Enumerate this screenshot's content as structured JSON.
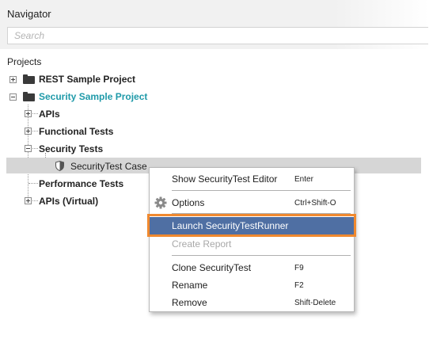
{
  "header": {
    "title": "Navigator"
  },
  "search": {
    "placeholder": "Search",
    "value": ""
  },
  "section": {
    "label": "Projects"
  },
  "tree": {
    "projects": [
      {
        "label": "REST Sample Project",
        "expanded": false
      },
      {
        "label": "Security Sample Project",
        "expanded": true
      }
    ],
    "children": [
      {
        "label": "APIs"
      },
      {
        "label": "Functional Tests"
      },
      {
        "label": "Security Tests"
      },
      {
        "label": "SecurityTest Case"
      },
      {
        "label": "Performance Tests"
      },
      {
        "label": "APIs (Virtual)"
      }
    ]
  },
  "context_menu": {
    "items": [
      {
        "label": "Show SecurityTest Editor",
        "shortcut": "Enter"
      },
      {
        "label": "Options",
        "shortcut": "Ctrl+Shift-O",
        "icon": "gear-icon"
      },
      {
        "label": "Launch SecurityTestRunner",
        "shortcut": ""
      },
      {
        "label": "Create Report",
        "shortcut": "",
        "disabled": true
      },
      {
        "label": "Clone SecurityTest",
        "shortcut": "F9"
      },
      {
        "label": "Rename",
        "shortcut": "F2"
      },
      {
        "label": "Remove",
        "shortcut": "Shift-Delete"
      }
    ]
  },
  "colors": {
    "accent_teal": "#1f9aa9",
    "menu_highlight": "#4f6fa3",
    "callout_orange": "#f0892f",
    "selection_gray": "#d6d6d6"
  }
}
